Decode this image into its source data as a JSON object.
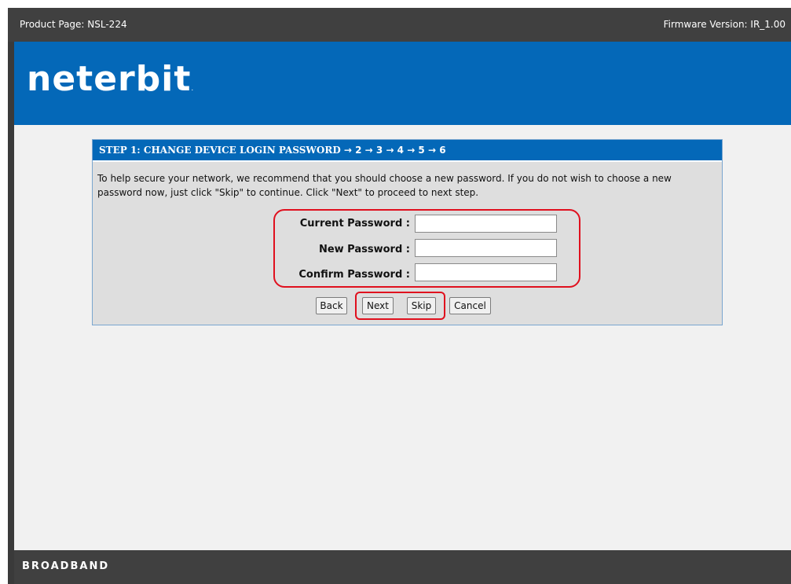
{
  "header": {
    "product": "Product Page: NSL-224",
    "firmware": "Firmware Version: IR_1.00"
  },
  "banner": {
    "logo_text": "neterbit",
    "logo_mark": "."
  },
  "step": {
    "title": "STEP 1: CHANGE DEVICE LOGIN PASSWORD",
    "steps": "→ 2 → 3 → 4 → 5 → 6",
    "description": "To help secure your network, we recommend that you should choose a new password. If you do not wish to choose a new password now, just click \"Skip\" to continue. Click \"Next\" to proceed to next step."
  },
  "form": {
    "current_label": "Current Password :",
    "current_value": "",
    "new_label": "New Password :",
    "new_value": "",
    "confirm_label": "Confirm Password :",
    "confirm_value": ""
  },
  "buttons": {
    "back": "Back",
    "next": "Next",
    "skip": "Skip",
    "cancel": "Cancel"
  },
  "footer": {
    "logo": "BROADBAND"
  },
  "colors": {
    "brand_blue": "#0468b8",
    "bar_dark": "#404040",
    "highlight_red": "#e0101e",
    "panel_gray": "#dedede"
  }
}
